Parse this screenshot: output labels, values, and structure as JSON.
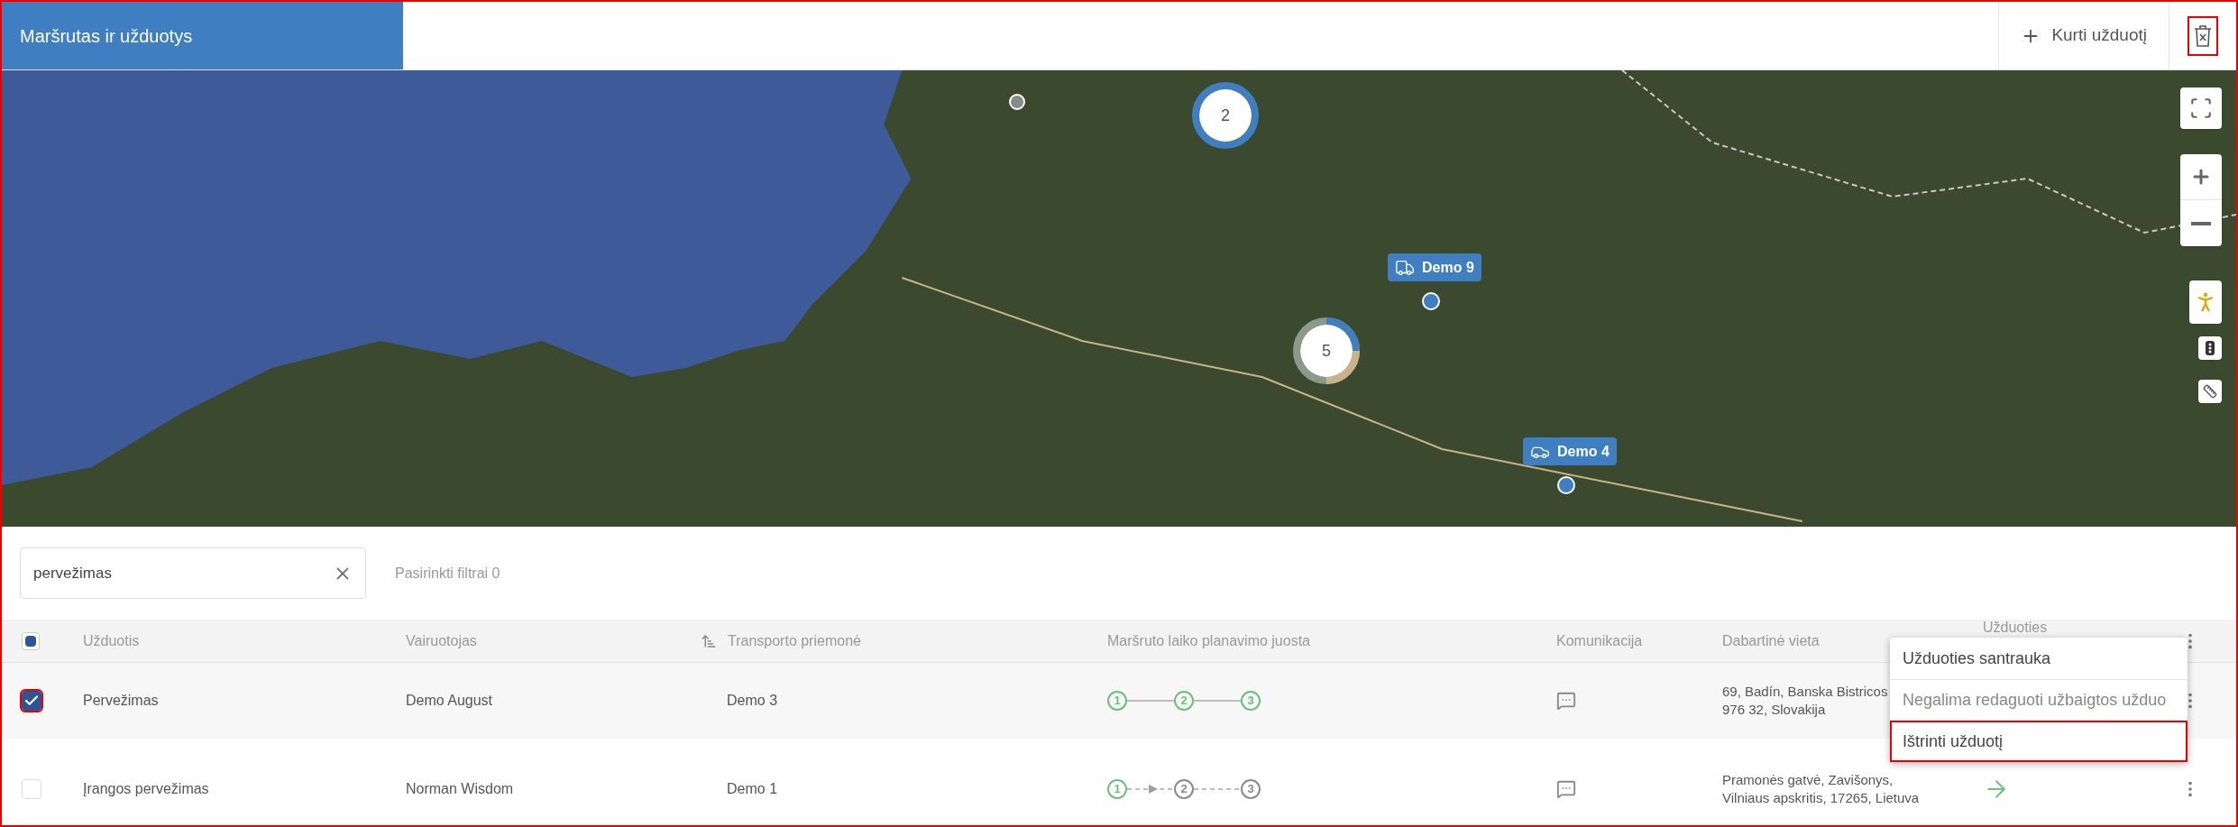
{
  "header": {
    "title": "Maršrutas ir užduotys",
    "create_button": "Kurti užduotį",
    "delete_highlighted": true
  },
  "map": {
    "markers": [
      {
        "kind": "inactive"
      },
      {
        "kind": "cluster",
        "count": "2"
      },
      {
        "kind": "truck",
        "label": "Demo 9"
      },
      {
        "kind": "cluster",
        "count": "5"
      },
      {
        "kind": "car",
        "label": "Demo 4"
      }
    ]
  },
  "filters": {
    "search": {
      "value": "pervežimas"
    },
    "selected_filters": "Pasirinkti filtrai 0"
  },
  "table": {
    "select_all_partial": true,
    "columns": [
      "Užduotis",
      "Vairuotojas",
      "Transporto priemonė",
      "Maršruto laiko planavimo juosta",
      "Komunikacija",
      "Dabartinė vieta",
      "Užduoties"
    ],
    "rows": [
      {
        "selected": true,
        "highlighted": true,
        "task": "Pervežimas",
        "driver": "Demo August",
        "vehicle": "Demo 3",
        "steps": [
          {
            "label": "1",
            "done": true
          },
          {
            "label": "2",
            "done": true
          },
          {
            "label": "3",
            "done": true
          }
        ],
        "location": [
          "69, Badín, Banska Bistricos",
          "976 32, Slovakija"
        ]
      },
      {
        "selected": false,
        "highlighted": false,
        "task": "Įrangos pervežimas",
        "driver": "Norman Wisdom",
        "vehicle": "Demo 1",
        "steps": [
          {
            "label": "1",
            "done": true
          },
          {
            "label": "2",
            "done": false
          },
          {
            "label": "3",
            "done": false
          }
        ],
        "location": [
          "Pramonės gatvė, Zavišonys,",
          "Vilniaus apskritis, 17265, Lietuva"
        ],
        "arrow": true
      }
    ]
  },
  "menu": {
    "items": [
      {
        "label": "Užduoties santrauka",
        "disabled": false,
        "highlighted": false
      },
      {
        "label": "Negalima redaguoti užbaigtos užduo",
        "disabled": true,
        "highlighted": false
      },
      {
        "label": "Ištrinti užduotį",
        "disabled": false,
        "highlighted": true
      }
    ]
  }
}
